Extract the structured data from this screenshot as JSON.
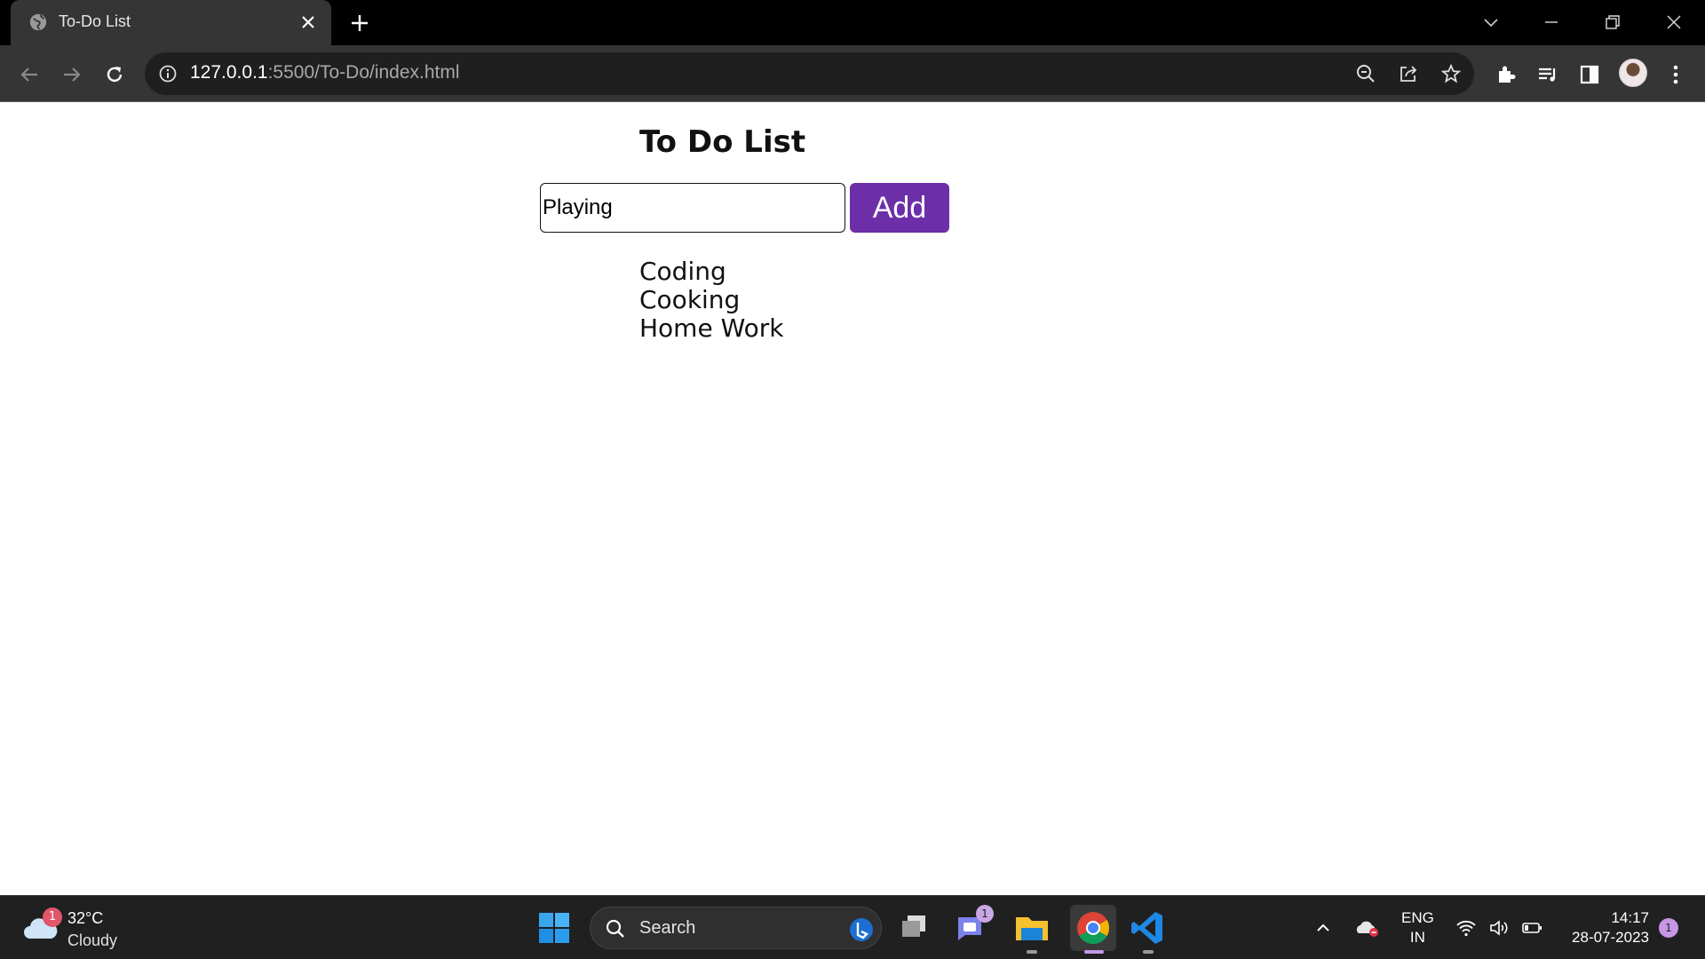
{
  "browser": {
    "tab_title": "To-Do List",
    "url_host": "127.0.0.1",
    "url_rest": ":5500/To-Do/index.html"
  },
  "page": {
    "title": "To Do List",
    "input_value": "Playing",
    "add_label": "Add",
    "tasks": [
      "Coding",
      "Cooking",
      "Home Work"
    ],
    "accent_color": "#6c2fa8"
  },
  "taskbar": {
    "weather_badge": "1",
    "weather_temp": "32°C",
    "weather_condition": "Cloudy",
    "search_label": "Search",
    "teams_badge": "1",
    "lang_line1": "ENG",
    "lang_line2": "IN",
    "time": "14:17",
    "date": "28-07-2023",
    "notification_count": "1"
  }
}
